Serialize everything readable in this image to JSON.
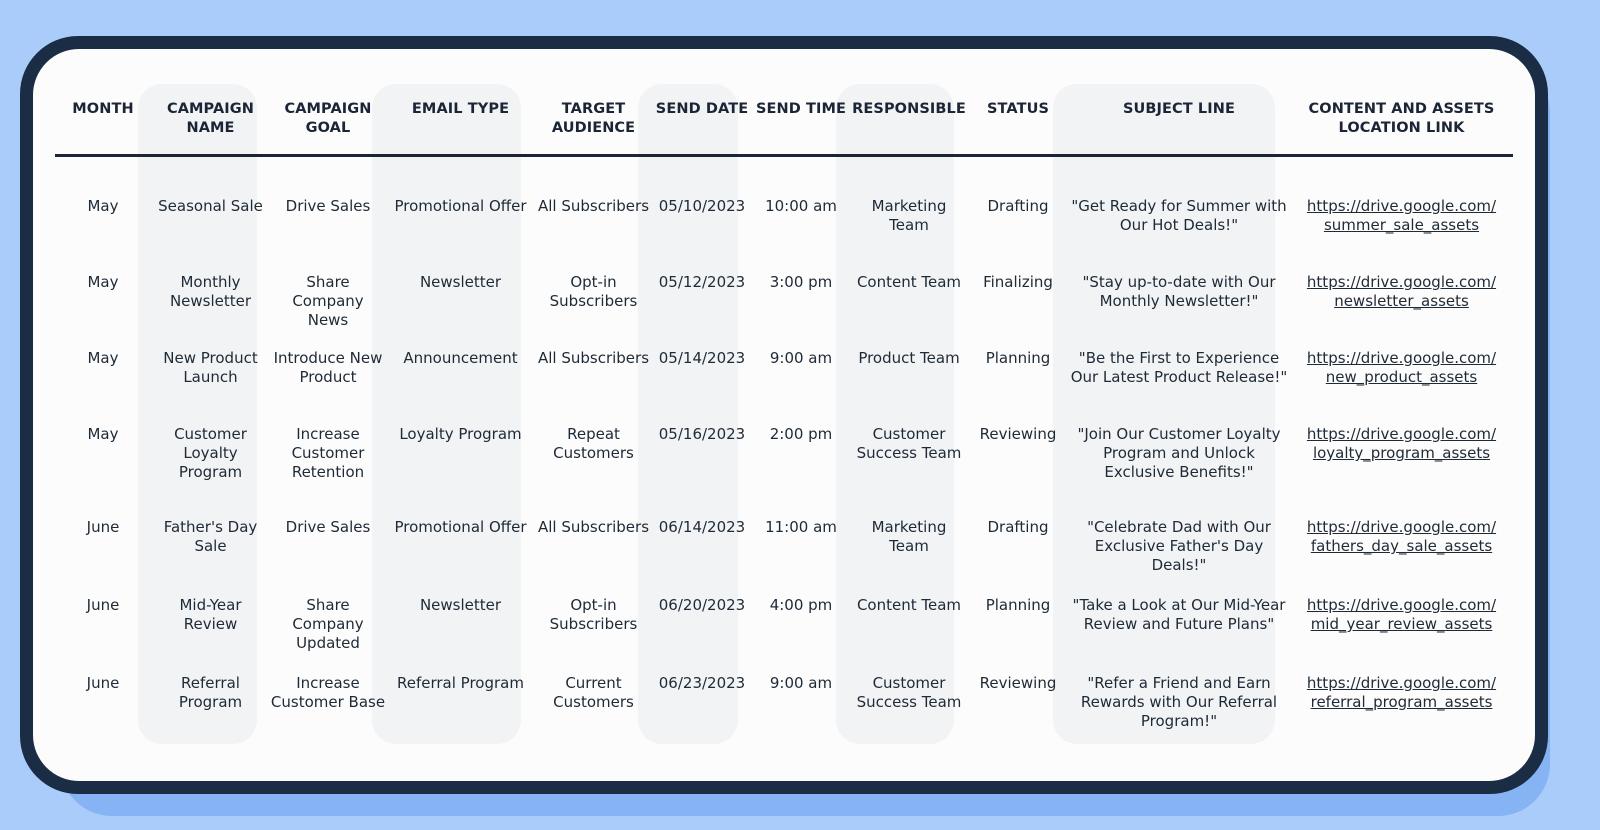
{
  "table": {
    "headers": [
      "MONTH",
      "CAMPAIGN NAME",
      "CAMPAIGN GOAL",
      "EMAIL TYPE",
      "TARGET AUDIENCE",
      "SEND DATE",
      "SEND TIME",
      "RESPONSIBLE",
      "STATUS",
      "SUBJECT LINE",
      "CONTENT AND ASSETS LOCATION LINK"
    ],
    "rows": [
      {
        "month": "May",
        "campaign_name": "Seasonal Sale",
        "campaign_goal": "Drive Sales",
        "email_type": "Promotional Offer",
        "target_audience": "All Subscribers",
        "send_date": "05/10/2023",
        "send_time": "10:00 am",
        "responsible": "Marketing Team",
        "status": "Drafting",
        "subject_line": "\"Get Ready for Summer with Our Hot Deals!\"",
        "link": "https://drive.google.com/summer_sale_assets"
      },
      {
        "month": "May",
        "campaign_name": "Monthly Newsletter",
        "campaign_goal": "Share Company News",
        "email_type": "Newsletter",
        "target_audience": "Opt-in Subscribers",
        "send_date": "05/12/2023",
        "send_time": "3:00 pm",
        "responsible": "Content Team",
        "status": "Finalizing",
        "subject_line": "\"Stay up-to-date with Our Monthly Newsletter!\"",
        "link": "https://drive.google.com/newsletter_assets"
      },
      {
        "month": "May",
        "campaign_name": "New Product Launch",
        "campaign_goal": "Introduce New Product",
        "email_type": "Announcement",
        "target_audience": "All Subscribers",
        "send_date": "05/14/2023",
        "send_time": "9:00 am",
        "responsible": "Product Team",
        "status": "Planning",
        "subject_line": "\"Be the First to Experience Our Latest Product Release!\"",
        "link": "https://drive.google.com/new_product_assets"
      },
      {
        "month": "May",
        "campaign_name": "Customer Loyalty Program",
        "campaign_goal": "Increase Customer Retention",
        "email_type": "Loyalty Program",
        "target_audience": "Repeat Customers",
        "send_date": "05/16/2023",
        "send_time": "2:00 pm",
        "responsible": "Customer Success Team",
        "status": "Reviewing",
        "subject_line": "\"Join Our Customer Loyalty Program and Unlock Exclusive Benefits!\"",
        "link": "https://drive.google.com/loyalty_program_assets"
      },
      {
        "month": "June",
        "campaign_name": "Father's Day Sale",
        "campaign_goal": "Drive Sales",
        "email_type": "Promotional Offer",
        "target_audience": "All Subscribers",
        "send_date": "06/14/2023",
        "send_time": "11:00 am",
        "responsible": "Marketing Team",
        "status": "Drafting",
        "subject_line": "\"Celebrate Dad with Our Exclusive Father's Day Deals!\"",
        "link": "https://drive.google.com/fathers_day_sale_assets"
      },
      {
        "month": "June",
        "campaign_name": "Mid-Year Review",
        "campaign_goal": "Share Company Updated",
        "email_type": "Newsletter",
        "target_audience": "Opt-in Subscribers",
        "send_date": "06/20/2023",
        "send_time": "4:00 pm",
        "responsible": "Content Team",
        "status": "Planning",
        "subject_line": "\"Take a Look at Our Mid-Year Review and Future Plans\"",
        "link": "https://drive.google.com/mid_year_review_assets"
      },
      {
        "month": "June",
        "campaign_name": "Referral Program",
        "campaign_goal": "Increase Customer Base",
        "email_type": "Referral Program",
        "target_audience": "Current Customers",
        "send_date": "06/23/2023",
        "send_time": "9:00 am",
        "responsible": "Customer Success Team",
        "status": "Reviewing",
        "subject_line": "\"Refer a Friend and Earn Rewards with Our Referral Program!\"",
        "link": "https://drive.google.com/referral_program_assets"
      }
    ]
  }
}
